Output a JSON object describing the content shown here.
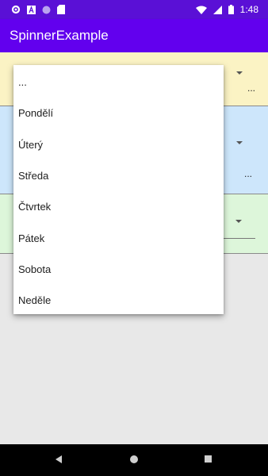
{
  "status_bar": {
    "time": "1:48",
    "left_icons": [
      "gear-icon",
      "font-icon",
      "circle-icon",
      "sd-card-icon"
    ],
    "right_icons": [
      "wifi-icon",
      "signal-icon",
      "battery-icon"
    ]
  },
  "app_bar": {
    "title": "SpinnerExample"
  },
  "panels": [
    {
      "value": "...",
      "color": "#fbf3c4"
    },
    {
      "value": "...",
      "color": "#cde6fb"
    },
    {
      "value": "",
      "color": "#ddf6da"
    }
  ],
  "dropdown": {
    "items": [
      "...",
      "Pondělí",
      "Úterý",
      "Středa",
      "Čtvrtek",
      "Pátek",
      "Sobota",
      "Neděle"
    ]
  },
  "nav_bar": {
    "icons": [
      "back-icon",
      "home-icon",
      "recents-icon"
    ]
  }
}
